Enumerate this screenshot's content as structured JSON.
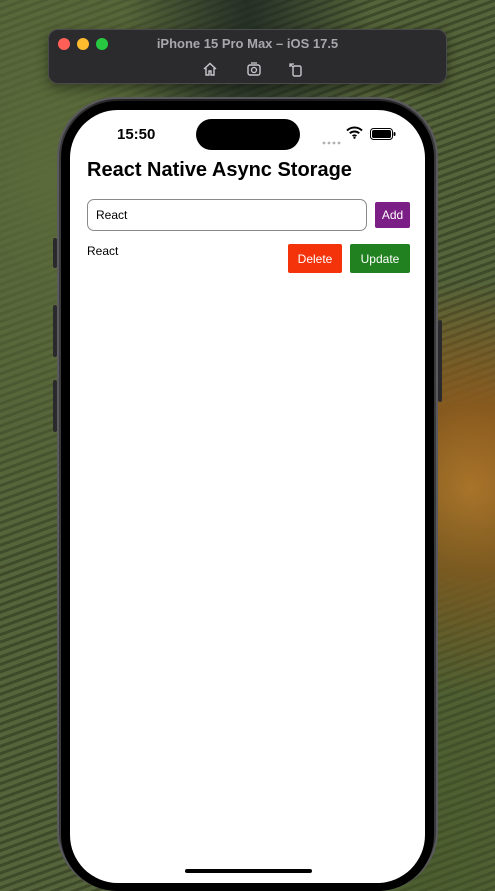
{
  "simulator": {
    "title": "iPhone 15 Pro Max – iOS 17.5",
    "tools": [
      "home-icon",
      "screenshot-icon",
      "rotate-icon"
    ]
  },
  "status_bar": {
    "time": "15:50",
    "icons": [
      "signal-icon",
      "wifi-icon",
      "battery-icon"
    ]
  },
  "app": {
    "title": "React Native Async Storage",
    "input": {
      "value": "React",
      "placeholder": ""
    },
    "add_label": "Add",
    "items": [
      {
        "text": "React",
        "delete_label": "Delete",
        "update_label": "Update"
      }
    ]
  },
  "colors": {
    "add_button": "#7b1e85",
    "delete_button": "#f4330a",
    "update_button": "#21801f"
  }
}
